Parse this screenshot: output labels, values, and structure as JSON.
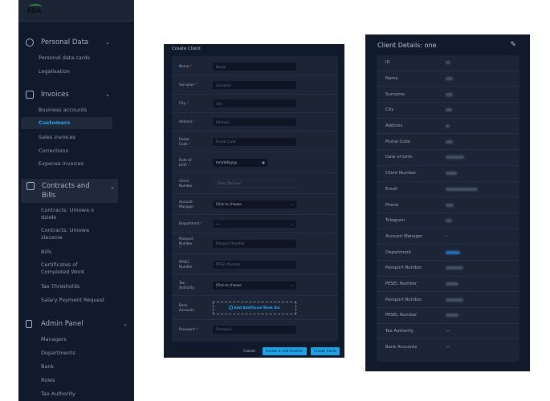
{
  "sidebar": {
    "logo": "FBA",
    "groups": [
      {
        "label": "Personal Data",
        "icon": "user-icon",
        "items": [
          "Personal data cards",
          "Legalisation"
        ]
      },
      {
        "label": "Invoices",
        "icon": "briefcase-icon",
        "items": [
          "Business accounts",
          "Customers",
          "Sales invoices",
          "Corrections",
          "Expense invoices"
        ],
        "active": "Customers"
      },
      {
        "label": "Contracts and Bills",
        "icon": "card-icon",
        "items": [
          "Contracts: Umowa o dzieło",
          "Contracts: Umowa zlecenie",
          "Bills",
          "Certificates of Completed Work",
          "Tax Thresholds",
          "Salary Payment Request"
        ]
      },
      {
        "label": "Admin Panel",
        "icon": "document-icon",
        "items": [
          "Managers",
          "Departments",
          "Bank",
          "Roles",
          "Tax Authority"
        ]
      }
    ]
  },
  "create_form": {
    "title": "Create Client",
    "fields": [
      {
        "label": "Name",
        "required": true,
        "placeholder": "Name"
      },
      {
        "label": "Surname",
        "required": true,
        "placeholder": "Surname"
      },
      {
        "label": "City",
        "required": true,
        "placeholder": "City"
      },
      {
        "label": "Address",
        "required": true,
        "placeholder": "Address"
      },
      {
        "label": "Postal Code",
        "required": true,
        "placeholder": "Postal Code"
      },
      {
        "label": "Date of birth",
        "required": true,
        "value": "mm/dd/yyyy"
      },
      {
        "label": "Client Number",
        "required": false,
        "placeholder": "Client Number"
      },
      {
        "label": "Account Manager",
        "required": false,
        "value": "Click to choose"
      },
      {
        "label": "Department",
        "required": true,
        "value": "---"
      },
      {
        "label": "Passport Number",
        "required": true,
        "placeholder": "Passport Number"
      },
      {
        "label": "PESEL Number",
        "required": false,
        "placeholder": "PESEL Number"
      },
      {
        "label": "Tax Authority",
        "required": false,
        "value": "Click to choose"
      },
      {
        "label": "Bank Accounts",
        "required": false,
        "button": "Add Additional Bank Acc"
      },
      {
        "label": "Password",
        "required": true,
        "placeholder": "Password"
      }
    ],
    "cancel": "Cancel",
    "create_another": "Create & Add Another",
    "create": "Create Client"
  },
  "details": {
    "title": "Client Details: one",
    "rows": [
      {
        "label": "ID"
      },
      {
        "label": "Name"
      },
      {
        "label": "Surname"
      },
      {
        "label": "City"
      },
      {
        "label": "Address"
      },
      {
        "label": "Postal Code"
      },
      {
        "label": "Date of birth"
      },
      {
        "label": "Client Number"
      },
      {
        "label": "Email"
      },
      {
        "label": "Phone"
      },
      {
        "label": "Telegram"
      },
      {
        "label": "Account Manager",
        "value": "-"
      },
      {
        "label": "Department"
      },
      {
        "label": "Passport Number"
      },
      {
        "label": "PESEL Number"
      },
      {
        "label": "Passport Number"
      },
      {
        "label": "PESEL Number"
      },
      {
        "label": "Tax Authority",
        "value": "—"
      },
      {
        "label": "Bank Accounts",
        "value": "—"
      }
    ]
  }
}
